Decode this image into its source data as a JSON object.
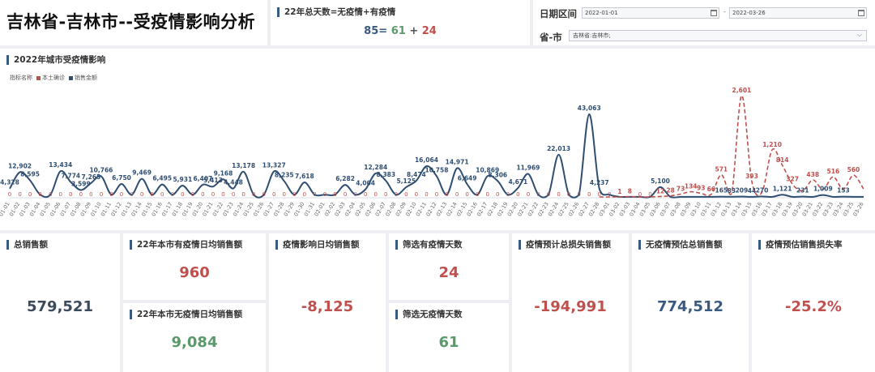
{
  "header": {
    "title": "吉林省-吉林市--受疫情影响分析",
    "days_title": "22年总天数=无疫情+有疫情",
    "days_total": "85",
    "days_eq": "=",
    "days_no_epidemic": "61",
    "days_plus": "+",
    "days_epidemic": "24"
  },
  "filters": {
    "date_label": "日期区间",
    "date_start": "2022-01-01",
    "date_sep": "-",
    "date_end": "2022-03-26",
    "region_label": "省-市",
    "region_value": "吉林省:吉林市;"
  },
  "chart": {
    "section_title": "2022年城市受疫情影响",
    "legend_title": "指标名称",
    "legend_items": [
      {
        "label": "本土确诊",
        "color": "#c0504d"
      },
      {
        "label": "销售金额",
        "color": "#2f4e72"
      }
    ]
  },
  "chart_data": {
    "type": "line",
    "x": [
      "01-01",
      "01-02",
      "01-03",
      "01-04",
      "01-05",
      "01-06",
      "01-07",
      "01-08",
      "01-09",
      "01-10",
      "01-11",
      "01-12",
      "01-13",
      "01-14",
      "01-15",
      "01-16",
      "01-17",
      "01-18",
      "01-19",
      "01-20",
      "01-21",
      "01-22",
      "01-23",
      "01-24",
      "01-25",
      "01-26",
      "01-27",
      "01-28",
      "01-29",
      "01-30",
      "01-31",
      "02-01",
      "02-02",
      "02-03",
      "02-04",
      "02-05",
      "02-06",
      "02-07",
      "02-08",
      "02-09",
      "02-10",
      "02-11",
      "02-12",
      "02-13",
      "02-14",
      "02-15",
      "02-16",
      "02-17",
      "02-18",
      "02-19",
      "02-20",
      "02-21",
      "02-22",
      "02-23",
      "02-24",
      "02-25",
      "02-26",
      "02-27",
      "02-28",
      "03-01",
      "03-02",
      "03-03",
      "03-04",
      "03-05",
      "03-06",
      "03-07",
      "03-08",
      "03-09",
      "03-10",
      "03-11",
      "03-12",
      "03-13",
      "03-14",
      "03-15",
      "03-16",
      "03-17",
      "03-18",
      "03-19",
      "03-20",
      "03-21",
      "03-22",
      "03-23",
      "03-24",
      "03-25",
      "03-26"
    ],
    "series": [
      {
        "name": "销售金额",
        "color": "#2f4e72",
        "values": [
          4328,
          12902,
          8595,
          null,
          null,
          13434,
          7774,
          3599,
          7265,
          10766,
          null,
          6750,
          null,
          9469,
          null,
          6495,
          null,
          5931,
          null,
          6407,
          5413,
          9168,
          4448,
          13178,
          null,
          null,
          13327,
          8235,
          null,
          7618,
          null,
          null,
          null,
          6282,
          null,
          4004,
          12284,
          8383,
          null,
          5125,
          8474,
          16064,
          10758,
          null,
          14971,
          6649,
          null,
          10869,
          8306,
          null,
          4671,
          11969,
          null,
          null,
          22013,
          null,
          null,
          43063,
          4237,
          null,
          null,
          null,
          null,
          null,
          5100,
          null,
          null,
          null,
          null,
          null,
          165,
          83,
          209,
          44,
          270,
          null,
          1121,
          null,
          231,
          null,
          1009,
          null,
          153,
          null,
          null
        ],
        "labels": [
          "4,328",
          "12,902",
          "8,595",
          "",
          "",
          "13,434",
          "7,774",
          "3,599",
          "7,265",
          "10,766",
          "",
          "6,750",
          "",
          "9,469",
          "",
          "6,495",
          "",
          "5,931",
          "",
          "6,407",
          "5,413",
          "9,168",
          "4,448",
          "13,178",
          "",
          "",
          "13,327",
          "8,235",
          "",
          "7,618",
          "",
          "",
          "",
          "6,282",
          "",
          "4,004",
          "12,284",
          "8,383",
          "",
          "5,125",
          "8,474",
          "16,064",
          "10,758",
          "",
          "14,971",
          "6,649",
          "",
          "10,869",
          "8,306",
          "",
          "4,671",
          "11,969",
          "",
          "",
          "22,013",
          "",
          "",
          "43,063",
          "4,237",
          "",
          "",
          "",
          "",
          "",
          "5,100",
          "",
          "",
          "",
          "",
          "",
          "165",
          "83",
          "209",
          "44",
          "270",
          "",
          "1,121",
          "",
          "231",
          "",
          "1,009",
          "",
          "153",
          "",
          ""
        ]
      },
      {
        "name": "本土确诊",
        "color": "#c0504d",
        "values": [
          0,
          0,
          0,
          0,
          0,
          0,
          0,
          0,
          0,
          0,
          0,
          0,
          0,
          0,
          0,
          0,
          0,
          0,
          0,
          0,
          0,
          0,
          0,
          0,
          0,
          0,
          0,
          0,
          0,
          0,
          0,
          0,
          0,
          0,
          0,
          0,
          0,
          0,
          0,
          0,
          0,
          0,
          0,
          0,
          0,
          0,
          0,
          0,
          0,
          0,
          0,
          0,
          0,
          0,
          0,
          0,
          0,
          0,
          0,
          0,
          1,
          8,
          0,
          0,
          12,
          28,
          73,
          134,
          93,
          66,
          571,
          null,
          2601,
          393,
          null,
          1210,
          814,
          327,
          null,
          438,
          null,
          516,
          null,
          560,
          null
        ],
        "labels": [
          "0",
          "0",
          "0",
          "0",
          "0",
          "0",
          "0",
          "0",
          "0",
          "0",
          "0",
          "0",
          "0",
          "0",
          "0",
          "0",
          "0",
          "0",
          "0",
          "0",
          "0",
          "0",
          "0",
          "0",
          "0",
          "0",
          "0",
          "0",
          "0",
          "0",
          "0",
          "0",
          "0",
          "0",
          "0",
          "0",
          "0",
          "0",
          "0",
          "0",
          "0",
          "0",
          "0",
          "0",
          "0",
          "0",
          "0",
          "0",
          "0",
          "0",
          "0",
          "0",
          "0",
          "0",
          "0",
          "0",
          "0",
          "0",
          "0",
          "0",
          "1",
          "8",
          "0",
          "0",
          "12",
          "28",
          "73",
          "134",
          "93",
          "66",
          "571",
          "",
          "2,601",
          "393",
          "",
          "1,210",
          "814",
          "327",
          "",
          "438",
          "",
          "516",
          "",
          "560",
          ""
        ]
      }
    ]
  },
  "kpis": {
    "total_sales": {
      "title": "总销售额",
      "value": "579,521"
    },
    "epi_daily": {
      "title": "22年本市有疫情日均销售额",
      "value": "960"
    },
    "noepi_daily": {
      "title": "22年本市无疫情日均销售额",
      "value": "9,084"
    },
    "impact_daily": {
      "title": "疫情影响日均销售额",
      "value": "-8,125"
    },
    "epi_days": {
      "title": "筛选有疫情天数",
      "value": "24"
    },
    "noepi_days": {
      "title": "筛选无疫情天数",
      "value": "61"
    },
    "est_loss": {
      "title": "疫情预计总损失销售额",
      "value": "-194,991"
    },
    "est_total": {
      "title": "无疫情预估总销售额",
      "value": "774,512"
    },
    "loss_rate": {
      "title": "疫情预估销售损失率",
      "value": "-25.2%"
    }
  }
}
